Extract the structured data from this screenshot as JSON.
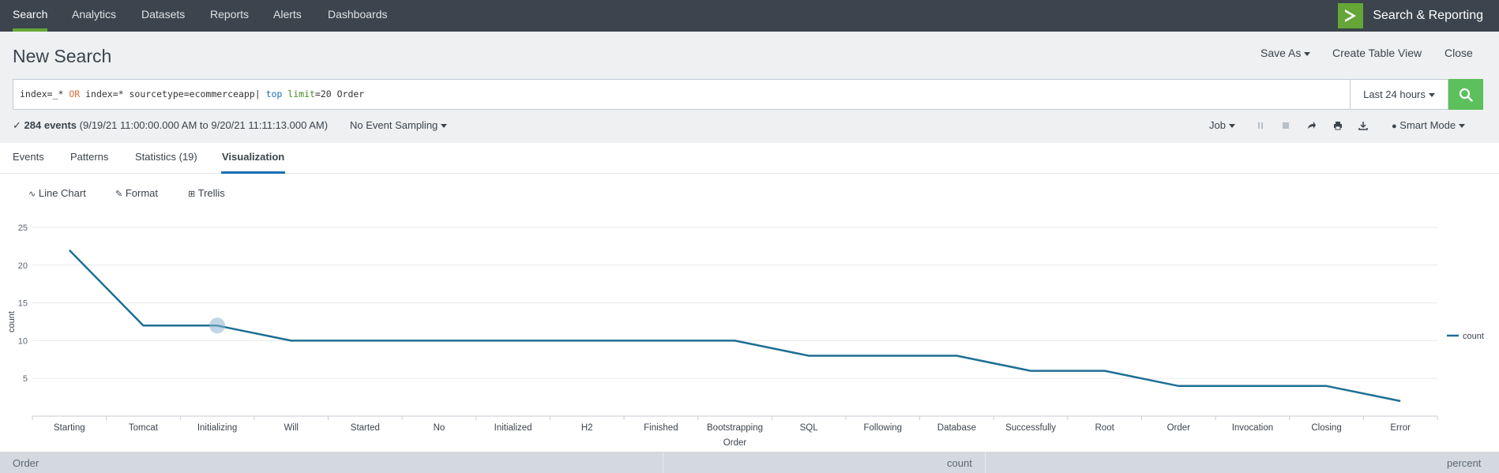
{
  "nav": {
    "items": [
      "Search",
      "Analytics",
      "Datasets",
      "Reports",
      "Alerts",
      "Dashboards"
    ],
    "active": "Search",
    "brand": "Search & Reporting"
  },
  "header": {
    "title": "New Search",
    "save_as": "Save As",
    "create_table_view": "Create Table View",
    "close": "Close"
  },
  "search": {
    "query_parts": {
      "p1": "index=_* ",
      "p2": "OR",
      "p3": " index=* sourcetype=ecommerceapp| ",
      "p4": "top",
      "p5": " ",
      "p6": "limit",
      "p7": "=20 Order"
    },
    "time_range": "Last 24 hours"
  },
  "status": {
    "check": "✓",
    "events": "284 events",
    "range": "(9/19/21 11:00:00.000 AM to 9/20/21 11:11:13.000 AM)",
    "sampling": "No Event Sampling",
    "job": "Job",
    "mode": "Smart Mode"
  },
  "tabs": [
    "Events",
    "Patterns",
    "Statistics (19)",
    "Visualization"
  ],
  "active_tab": "Visualization",
  "viz_toolbar": {
    "chart_type": "Line Chart",
    "format": "Format",
    "trellis": "Trellis"
  },
  "chart_data": {
    "type": "line",
    "xlabel": "Order",
    "ylabel": "count",
    "categories": [
      "Starting",
      "Tomcat",
      "Initializing",
      "Will",
      "Started",
      "No",
      "Initialized",
      "H2",
      "Finished",
      "Bootstrapping",
      "SQL",
      "Following",
      "Database",
      "Successfully",
      "Root",
      "Order",
      "Invocation",
      "Closing",
      "Error"
    ],
    "series": [
      {
        "name": "count",
        "values": [
          22,
          12,
          12,
          10,
          10,
          10,
          10,
          10,
          10,
          10,
          8,
          8,
          8,
          6,
          6,
          4,
          4,
          4,
          2
        ]
      }
    ],
    "ylim": [
      0,
      25
    ],
    "yticks": [
      5,
      10,
      15,
      20,
      25
    ],
    "grid": true,
    "legend": "right",
    "color": "#1e6f94",
    "highlighted_category": "Initializing"
  },
  "results_header": [
    "Order",
    "count",
    "percent"
  ],
  "colors": {
    "nav_bg": "#3c444d",
    "accent_green": "#65a637",
    "search_button": "#5cc05c",
    "active_tab_underline": "#1a6fb5"
  }
}
